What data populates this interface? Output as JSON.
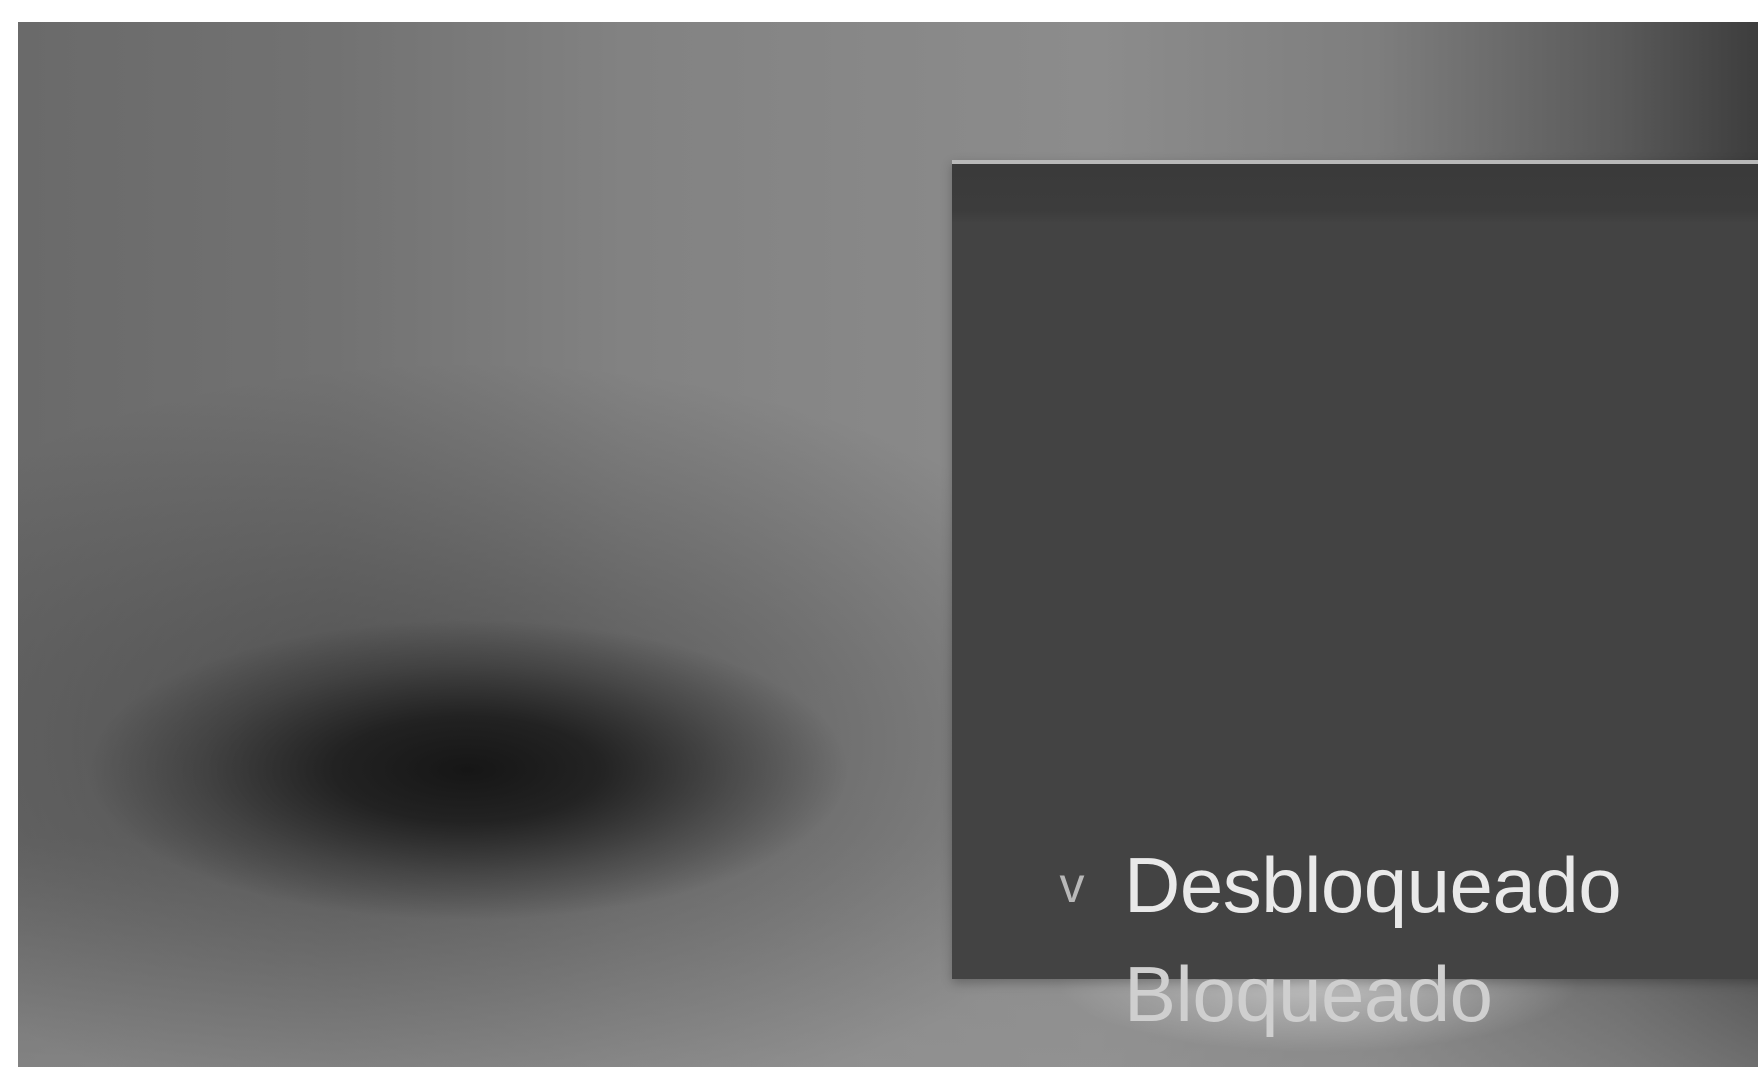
{
  "menu": {
    "options": [
      {
        "label": "Desbloqueado",
        "selected": true,
        "check_mark": "v"
      },
      {
        "label": "Bloqueado",
        "selected": false
      }
    ]
  },
  "colors": {
    "panel_background": "#434343",
    "panel_top_border": "#b9b9b9",
    "selected_text": "#e9e9e9",
    "text": "#cfcfcf"
  }
}
